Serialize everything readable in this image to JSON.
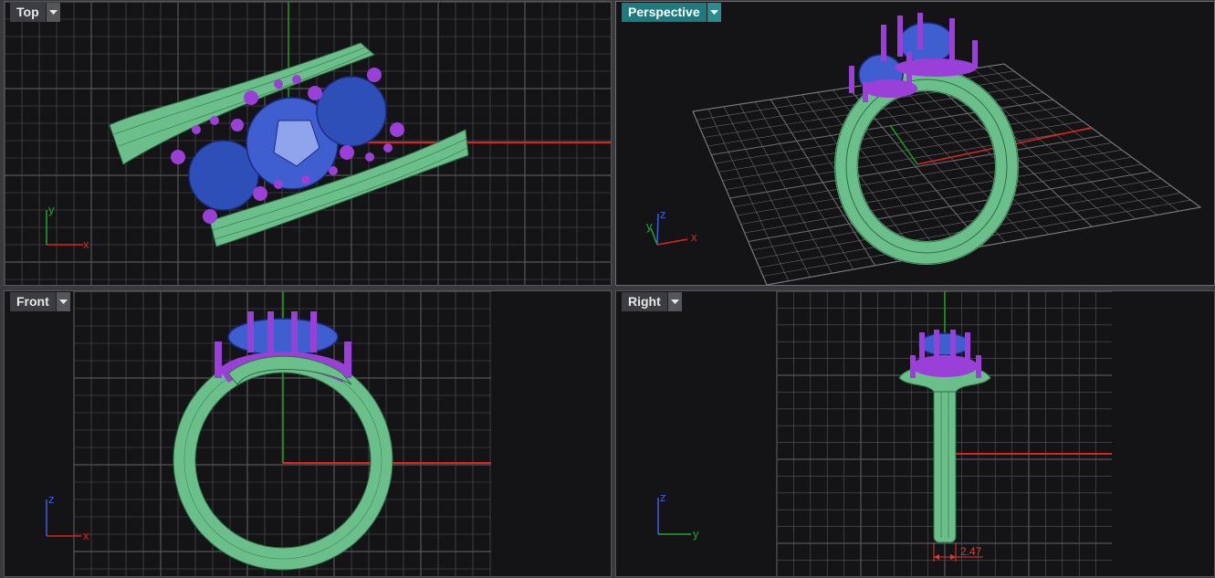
{
  "viewports": {
    "top": {
      "label": "Top",
      "active": false,
      "axes": [
        "x",
        "y"
      ]
    },
    "perspective": {
      "label": "Perspective",
      "active": true,
      "axes": [
        "x",
        "y",
        "z"
      ]
    },
    "front": {
      "label": "Front",
      "active": false,
      "axes": [
        "x",
        "z"
      ]
    },
    "right": {
      "label": "Right",
      "active": false,
      "axes": [
        "y",
        "z"
      ]
    }
  },
  "dimension": {
    "value": "2.47"
  },
  "icons": {
    "dropdown": "chevron-down-icon"
  },
  "colors": {
    "viewport_bg": "#141417",
    "grid": "#5a5a5e",
    "active_tab": "#1f7a7f",
    "axis_x": "#e0241c",
    "axis_y": "#22a82c",
    "axis_z": "#3a5fe0",
    "metal": "#6bbf8a",
    "stone": "#3f5fd0",
    "prong": "#9a3fd8"
  }
}
